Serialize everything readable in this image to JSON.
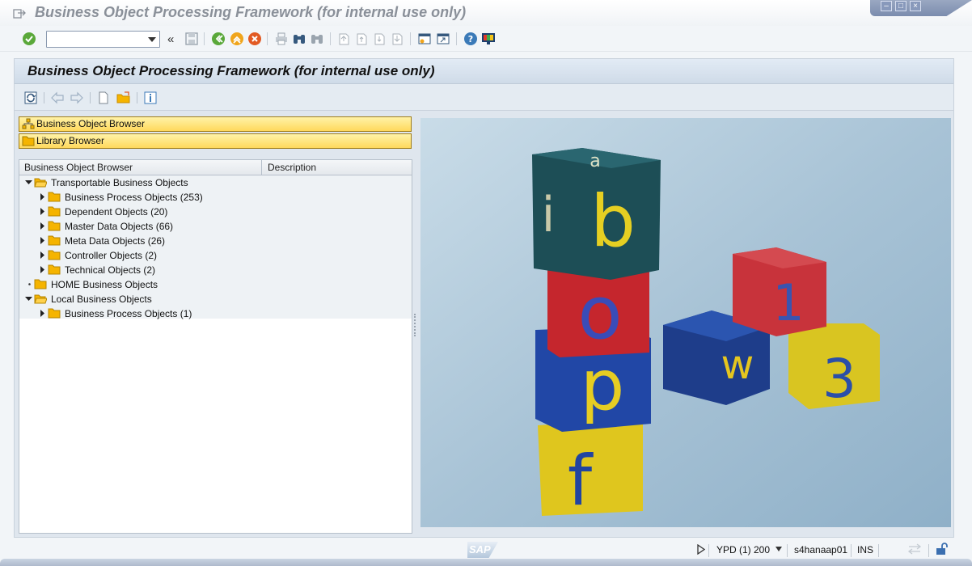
{
  "window": {
    "title": "Business Object Processing Framework (for internal use only)"
  },
  "system_toolbar": {
    "command_field_value": "",
    "command_field_placeholder": "",
    "back_symbol": "«"
  },
  "panel": {
    "title": "Business Object Processing Framework (for internal use only)"
  },
  "nav_buttons": [
    {
      "label": "Business Object Browser",
      "icon": "hierarchy-icon"
    },
    {
      "label": "Library Browser",
      "icon": "folder-icon"
    }
  ],
  "tree": {
    "columns": [
      "Business Object Browser",
      "Description"
    ],
    "nodes": [
      {
        "label": "Transportable Business Objects",
        "level": 0,
        "state": "expanded"
      },
      {
        "label": "Business Process Objects (253)",
        "level": 1,
        "state": "collapsed"
      },
      {
        "label": "Dependent Objects (20)",
        "level": 1,
        "state": "collapsed"
      },
      {
        "label": "Master Data Objects (66)",
        "level": 1,
        "state": "collapsed"
      },
      {
        "label": "Meta Data Objects (26)",
        "level": 1,
        "state": "collapsed"
      },
      {
        "label": "Controller Objects (2)",
        "level": 1,
        "state": "collapsed"
      },
      {
        "label": "Technical Objects (2)",
        "level": 1,
        "state": "collapsed"
      },
      {
        "label": "HOME Business Objects",
        "level": 0,
        "state": "leaf"
      },
      {
        "label": "Local Business Objects",
        "level": 0,
        "state": "expanded"
      },
      {
        "label": "Business Process Objects (1)",
        "level": 1,
        "state": "collapsed"
      }
    ]
  },
  "image": {
    "block_letters": [
      "a",
      "i",
      "b",
      "o",
      "p",
      "f",
      "1",
      "w",
      "3"
    ]
  },
  "status_bar": {
    "logo": "SAP",
    "system": "YPD (1) 200",
    "server": "s4hanaap01",
    "mode": "INS"
  },
  "colors": {
    "accent_yellow": "#ffd85c",
    "folder": "#f5b400",
    "panel_bg": "#dfe6ee"
  }
}
